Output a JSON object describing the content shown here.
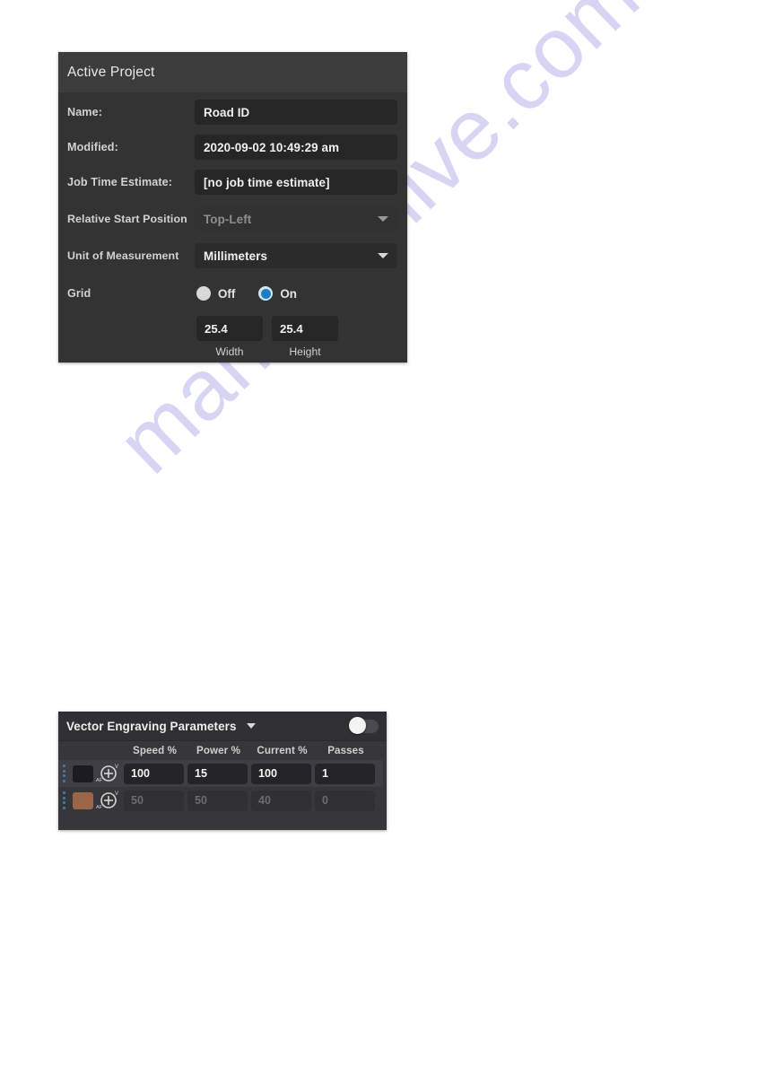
{
  "page": {
    "background": "#ffffff",
    "watermark": "manualshive.com",
    "watermark_color": "#cfcdf2"
  },
  "active_project": {
    "title": "Active Project",
    "fields": {
      "name_label": "Name:",
      "name_value": "Road ID",
      "modified_label": "Modified:",
      "modified_value": "2020-09-02 10:49:29 am",
      "job_time_label": "Job Time Estimate:",
      "job_time_value": "[no job time estimate]",
      "relative_start_label": "Relative Start Position",
      "relative_start_value": "Top-Left",
      "unit_label": "Unit of Measurement",
      "unit_value": "Millimeters",
      "grid_label": "Grid"
    },
    "grid_options": [
      {
        "label": "Off",
        "selected": false
      },
      {
        "label": "On",
        "selected": true
      }
    ],
    "grid_size": {
      "width_value": "25.4",
      "width_caption": "Width",
      "height_value": "25.4",
      "height_caption": "Height"
    },
    "colors": {
      "panel_bg": "#333334",
      "titlebar_bg": "#3c3c3d",
      "field_bg": "#262627",
      "accent_blue": "#1a7fc1",
      "disabled_text": "#8e8e8e"
    }
  },
  "vector_engraving": {
    "title": "Vector Engraving Parameters",
    "toggle_on": false,
    "columns": [
      "Speed %",
      "Power %",
      "Current %",
      "Passes"
    ],
    "rows": [
      {
        "swatch_color": "#1c1c1e",
        "enabled": true,
        "speed": "100",
        "power": "15",
        "current": "100",
        "passes": "1"
      },
      {
        "swatch_color": "#9c6547",
        "enabled": false,
        "speed": "50",
        "power": "50",
        "current": "40",
        "passes": "0"
      }
    ],
    "colors": {
      "panel_bg": "#37373a",
      "titlebar_bg": "#303032",
      "row_active_bg": "#3e3e44",
      "handle_blue": "#3d7fb5"
    }
  }
}
